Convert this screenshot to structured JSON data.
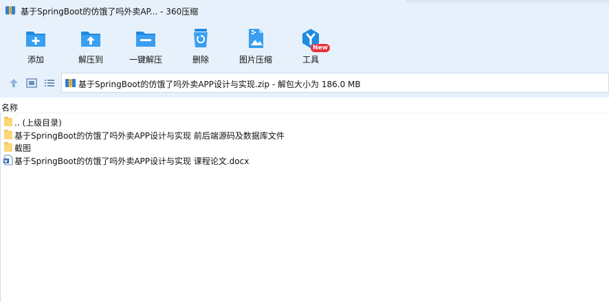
{
  "window": {
    "title": "基于SpringBoot的仿饿了吗外卖AP... - 360压缩"
  },
  "toolbar": {
    "items": [
      {
        "label": "添加",
        "icon": "folder-add-icon"
      },
      {
        "label": "解压到",
        "icon": "folder-extract-icon"
      },
      {
        "label": "一键解压",
        "icon": "folder-onekey-extract-icon"
      },
      {
        "label": "删除",
        "icon": "recycle-bin-icon"
      },
      {
        "label": "图片压缩",
        "icon": "image-compress-icon"
      },
      {
        "label": "工具",
        "icon": "tools-icon"
      }
    ],
    "badge": "New"
  },
  "address": {
    "path": "基于SpringBoot的仿饿了吗外卖APP设计与实现.zip - 解包大小为 186.0 MB"
  },
  "list": {
    "column_name": "名称",
    "rows": [
      {
        "name": ".. (上级目录)",
        "type": "parent-folder"
      },
      {
        "name": "基于SpringBoot的仿饿了吗外卖APP设计与实现 前后端源码及数据库文件",
        "type": "folder"
      },
      {
        "name": "截图",
        "type": "folder"
      },
      {
        "name": "基于SpringBoot的仿饿了吗外卖APP设计与实现 课程论文.docx",
        "type": "docx"
      }
    ]
  },
  "colors": {
    "accent": "#1f8be0",
    "toolbar_bg": "#e7f1fc",
    "badge": "#e8303a",
    "folder": "#f5c85a"
  }
}
